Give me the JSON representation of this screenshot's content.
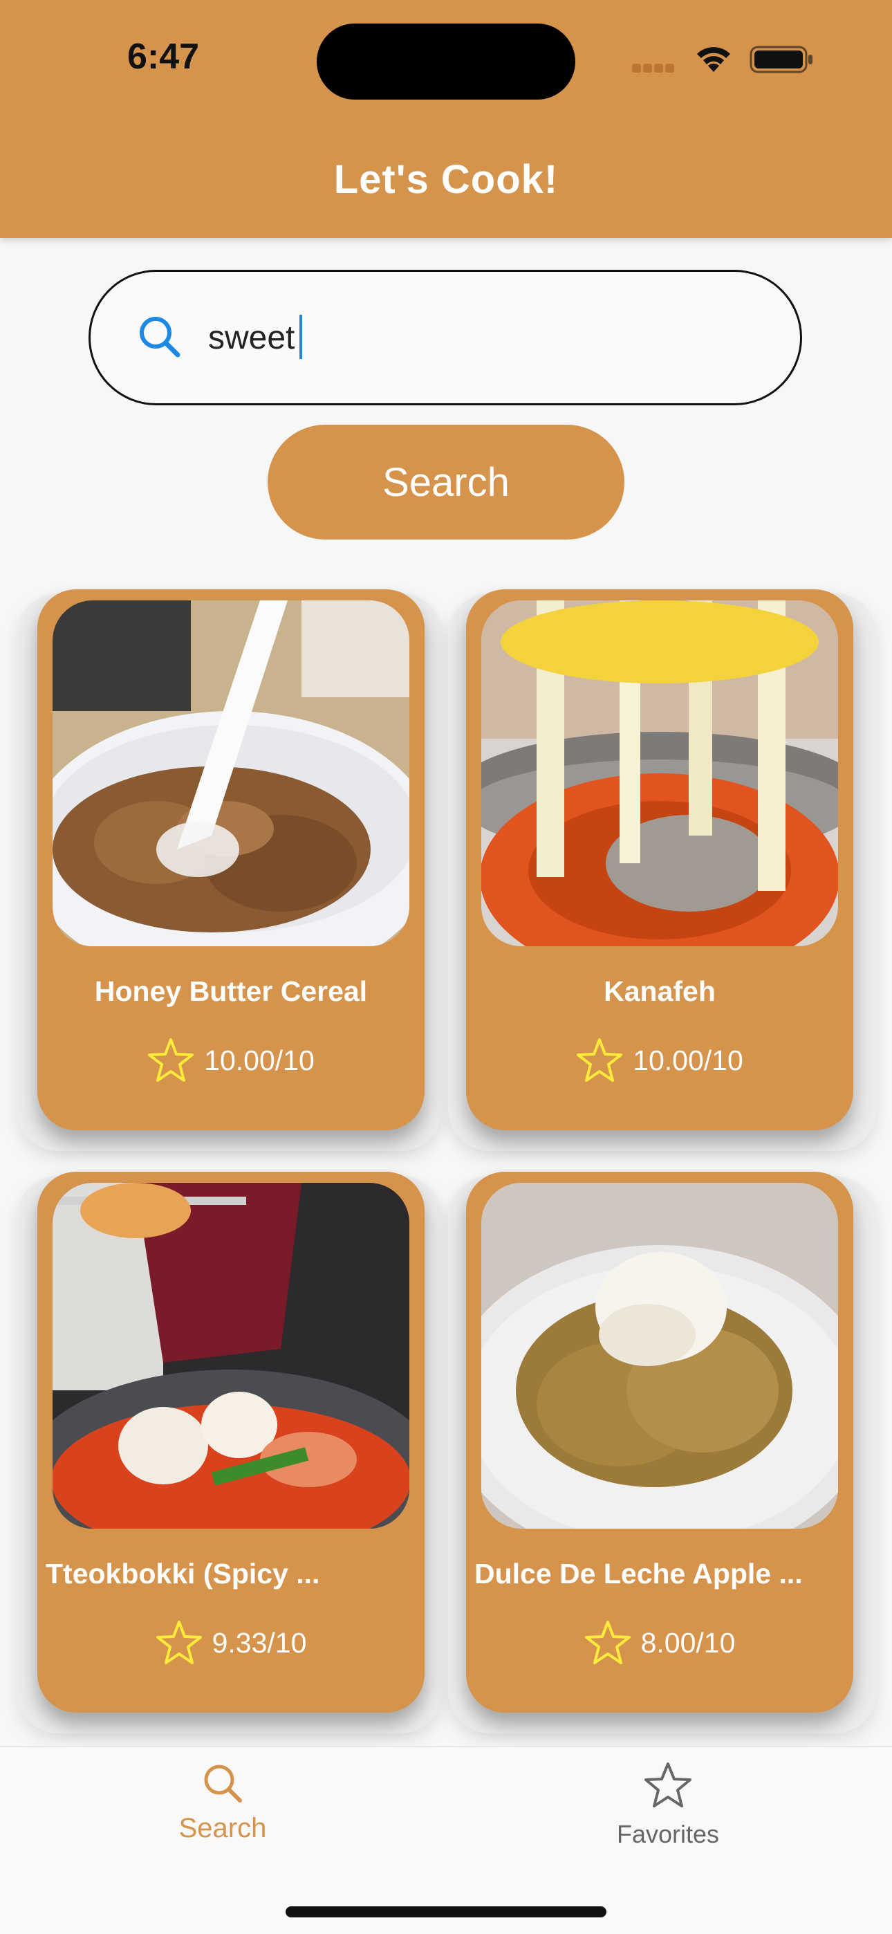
{
  "status_bar": {
    "time": "6:47"
  },
  "header": {
    "title": "Let's Cook!"
  },
  "search": {
    "value": "sweet",
    "button_label": "Search"
  },
  "recipes": [
    {
      "name": "Honey Butter Cereal",
      "rating": "10.00/10"
    },
    {
      "name": "Kanafeh",
      "rating": "10.00/10"
    },
    {
      "name": "Tteokbokki (Spicy ...",
      "rating": "9.33/10"
    },
    {
      "name": "Dulce De Leche Apple ...",
      "rating": "8.00/10"
    }
  ],
  "tabbar": {
    "tabs": [
      {
        "label": "Search",
        "icon": "search-icon",
        "active": true
      },
      {
        "label": "Favorites",
        "icon": "star-outline-icon",
        "active": false
      }
    ]
  },
  "colors": {
    "accent": "#d6934c",
    "star": "#ffeb3b",
    "search_icon": "#1e88e5"
  }
}
